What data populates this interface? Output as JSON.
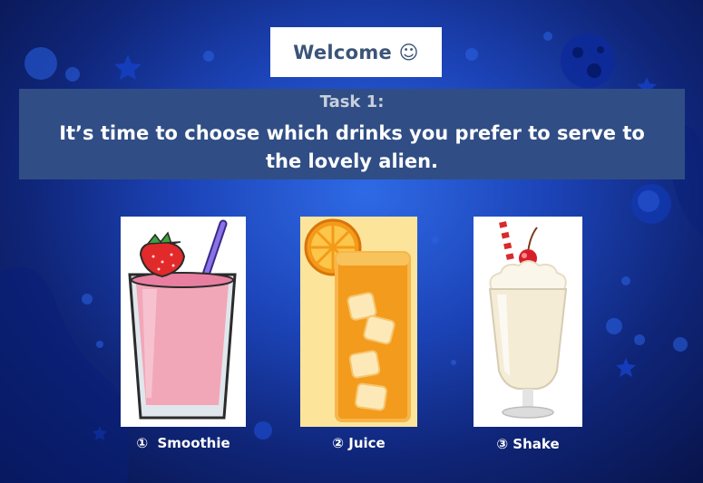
{
  "header": {
    "welcome": "Welcome ☺"
  },
  "task": {
    "title": "Task 1:",
    "prompt": "It’s time to choose which drinks you prefer to serve to the lovely alien."
  },
  "drinks": [
    {
      "number": "①",
      "label": "Smoothie",
      "icon": "smoothie-icon"
    },
    {
      "number": "②",
      "label": "Juice",
      "icon": "juice-icon"
    },
    {
      "number": "③",
      "label": "Shake",
      "icon": "milkshake-icon"
    }
  ],
  "colors": {
    "background": "#1c44b8",
    "task_panel": "#304e85",
    "welcome_text": "#3b5478",
    "task_title": "#c8d0dc"
  }
}
